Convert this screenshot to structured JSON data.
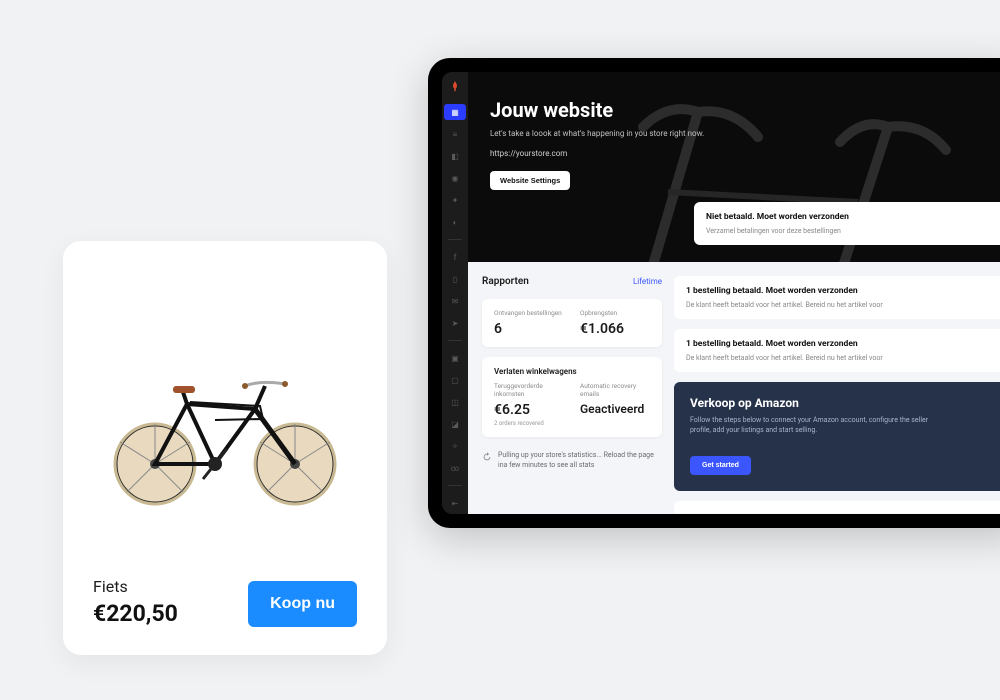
{
  "product": {
    "title": "Fiets",
    "price": "€220,50",
    "buy_label": "Koop nu"
  },
  "tablet": {
    "hero": {
      "title": "Jouw website",
      "subtitle": "Let's take a loook at what's happening in you store right now.",
      "url": "https://yourstore.com",
      "settings_button": "Website Settings"
    },
    "notices": [
      {
        "title": "Niet betaald. Moet worden verzonden",
        "sub": "Verzamel betalingen voor deze bestellingen"
      },
      {
        "title": "1 bestelling betaald. Moet worden verzonden",
        "sub": "De klant heeft betaald voor het artikel. Bereid nu het artikel voor"
      },
      {
        "title": "1 bestelling betaald. Moet worden verzonden",
        "sub": "De klant heeft betaald voor het artikel. Bereid nu het artikel voor"
      }
    ],
    "reports": {
      "title": "Rapporten",
      "range_label": "Lifetime",
      "orders_label": "Ontvangen bestellingen",
      "orders_value": "6",
      "revenue_label": "Opbrengsten",
      "revenue_value": "€1.066",
      "abandoned_title": "Verlaten winkelwagens",
      "recovered_label": "Teruggevorderde inkomsten",
      "recovered_value": "€6.25",
      "recovered_sub": "2 orders recovered",
      "auto_label": "Automatic recovery emails",
      "auto_value": "Geactiveerd",
      "loading_note": "Pulling up your store's statistics... Reload the page ina few minutes to see all stats"
    },
    "amazon": {
      "title": "Verkoop op Amazon",
      "sub": "Follow the steps below to connect your Amazon account, configure the seller profile, add your listings and start selling.",
      "button": "Get started"
    }
  }
}
